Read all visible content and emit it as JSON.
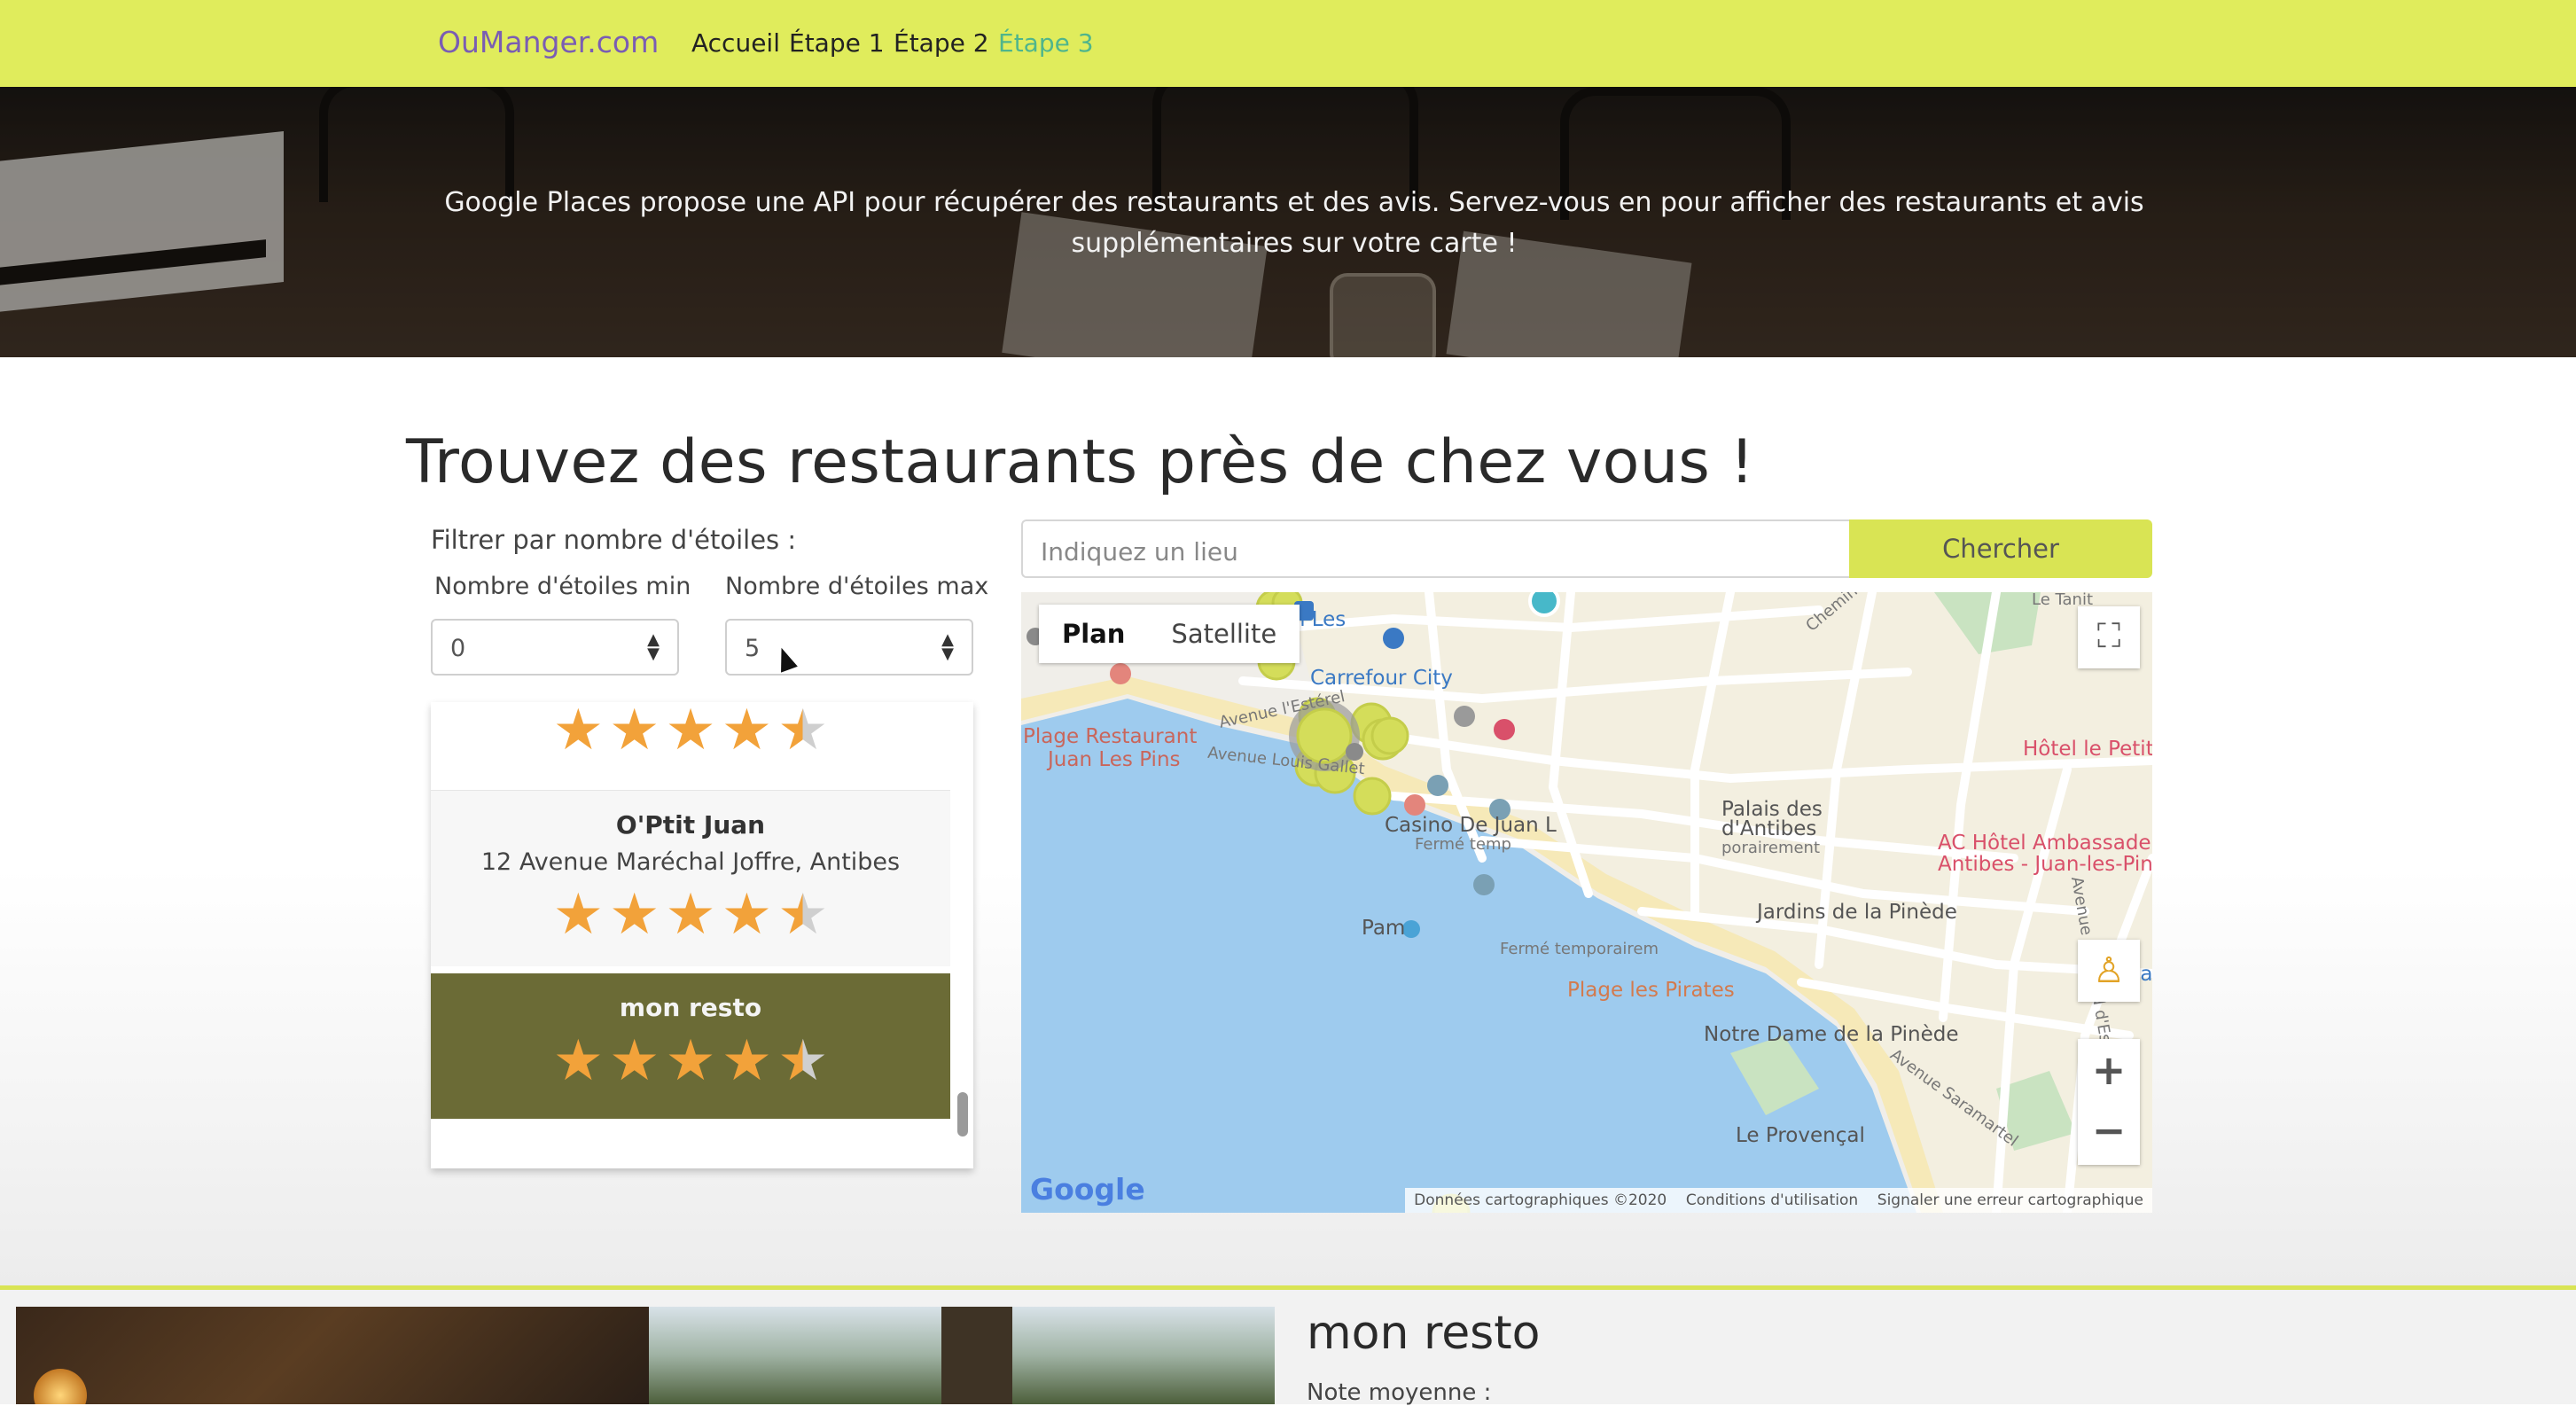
{
  "nav": {
    "brand": "OuManger.com",
    "links": [
      "Accueil",
      "Étape 1",
      "Étape 2",
      "Étape 3"
    ],
    "active_index": 3,
    "color": "#e0ec5c"
  },
  "hero": {
    "text": "Google Places propose une API pour récupérer des restaurants et des avis. Servez-vous en pour afficher des restaurants et avis supplémentaires sur votre carte !"
  },
  "main": {
    "title": "Trouvez des restaurants près de chez vous !",
    "filter": {
      "label": "Filtrer par nombre d'étoiles :",
      "min_label": "Nombre d'étoiles min",
      "min_value": "0",
      "max_label": "Nombre d'étoiles max",
      "max_value": "5"
    },
    "list": [
      {
        "name": "",
        "address": "",
        "rating": 4.5,
        "state": "partial-top"
      },
      {
        "name": "O'Ptit Juan",
        "address": "12 Avenue Maréchal Joffre, Antibes",
        "rating": 4.5
      },
      {
        "name": "mon resto",
        "address": "",
        "rating": 4.5,
        "selected": true
      }
    ],
    "search": {
      "placeholder": "Indiquez un lieu",
      "button": "Chercher"
    }
  },
  "map": {
    "type_controls": [
      "Plan",
      "Satellite"
    ],
    "active_type": "Plan",
    "labels": {
      "gare": "Gare de Juan Les",
      "carrefour": "Carrefour City",
      "plage_resto_1": "Plage Restaurant",
      "plage_resto_2": "Juan Les Pins",
      "casino": "Casino De Juan L",
      "ferme1": "Fermé temp",
      "palais_1": "Palais des",
      "palais_2": "d'Antibes",
      "palais_3": "porairement",
      "ac_hotel_1": "AC Hôtel Ambassadeu",
      "ac_hotel_2": "Antibes - Juan-les-Pins",
      "hotel_petit": "Hôtel le Petit",
      "tanit": "Le Tanit",
      "pam": "Pam",
      "ferme2": "Fermé temporairem",
      "jardins": "Jardins de la Pinède",
      "plage_pirates": "Plage les Pirates",
      "notre_dame": "Notre Dame de la Pinède",
      "provencal": "Le Provençal",
      "ave_esterel": "Avenue l'Estérel",
      "ave_gallet": "Avenue Louis Gallet",
      "ave_edmond": "Avenue Edmond d'Esclevin",
      "ave_sarment": "Avenue Saramartel",
      "chemin": "Chemin",
      "la": "la"
    },
    "google_logo": "Google",
    "attribution": [
      "Données cartographiques ©2020",
      "Conditions d'utilisation",
      "Signaler une erreur cartographique"
    ],
    "zoom_in": "+",
    "zoom_out": "−",
    "colors": {
      "marker": "#d4dd5a",
      "water": "#9ecbee",
      "land": "#f0eee9",
      "park": "#c9e3c1"
    }
  },
  "detail": {
    "title": "mon resto",
    "subtitle": "Note moyenne :"
  }
}
